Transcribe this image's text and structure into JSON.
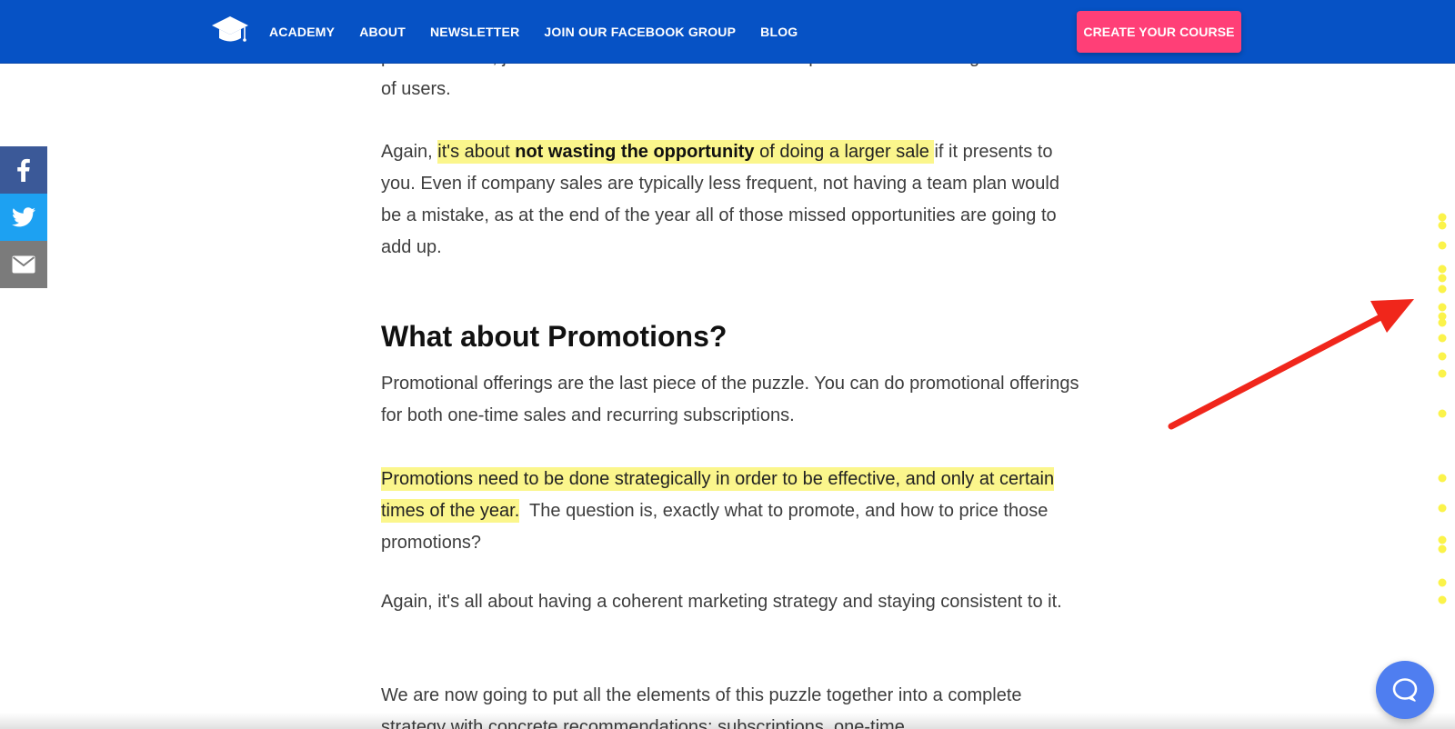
{
  "header": {
    "nav": [
      "ACADEMY",
      "ABOUT",
      "NEWSLETTER",
      "JOIN OUR FACEBOOK GROUP",
      "BLOG"
    ],
    "cta_label": "CREATE YOUR COURSE"
  },
  "share": {
    "icons": [
      "facebook-icon",
      "twitter-icon",
      "email-icon"
    ]
  },
  "article": {
    "partial_top": "plan available, just in case that someone wants to request access to a larger number of users.",
    "p1": {
      "lead": "Again, ",
      "hl_a": "it's about ",
      "hl_bold": "not wasting the opportunity",
      "hl_b": " of doing a larger sale ",
      "rest": "if it presents to you. Even if company sales are typically less frequent, not having a team plan would be a mistake, as at the end of the year all of those missed opportunities are going to add up."
    },
    "heading": "What about Promotions?",
    "p2": "Promotional offerings are the last piece of the puzzle. You can do promotional offerings for both one-time sales and recurring subscriptions.",
    "p3": {
      "highlight": "Promotions need to be done strategically in order to be effective, and only at certain times of the year.",
      "rest": "  The question is, exactly what to promote, and how to price those promotions?"
    },
    "p4": "Again, it's all about having a coherent marketing strategy and staying consistent to it.",
    "p5": "We are now going to put all the elements of this puzzle together into a complete strategy with concrete recommendations: subscriptions, one-time"
  },
  "colors": {
    "header_bg": "#0652c5",
    "cta_bg": "#ff3f77",
    "highlight": "#fbf68c",
    "arrow": "#f0261b",
    "chat_bubble": "#4f7ef0"
  }
}
